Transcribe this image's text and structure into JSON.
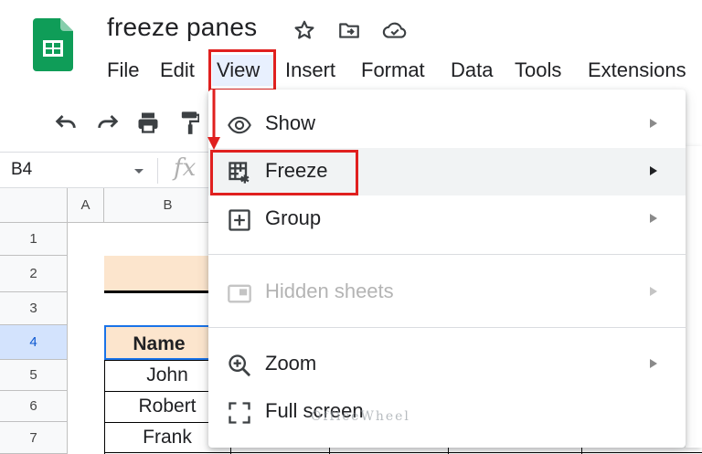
{
  "app": {
    "doc_title": "freeze panes",
    "brand_color": "#0f9d58",
    "highlight_color": "#e0201f"
  },
  "header": {
    "icons": [
      "star-icon",
      "move-to-folder-icon",
      "cloud-status-icon"
    ]
  },
  "menubar": {
    "items": [
      {
        "label": "File"
      },
      {
        "label": "Edit"
      },
      {
        "label": "View"
      },
      {
        "label": "Insert"
      },
      {
        "label": "Format"
      },
      {
        "label": "Data"
      },
      {
        "label": "Tools"
      },
      {
        "label": "Extensions"
      }
    ],
    "active": "View"
  },
  "toolbar": {
    "icons": [
      "undo-icon",
      "redo-icon",
      "print-icon",
      "paint-format-icon"
    ]
  },
  "formula_bar": {
    "name_box": "B4",
    "fx_label": "fx"
  },
  "grid": {
    "columns": [
      "A",
      "B"
    ],
    "rows": [
      "1",
      "2",
      "3",
      "4",
      "5",
      "6",
      "7"
    ],
    "selected_row": "4",
    "cells": {
      "b4": "Name",
      "b5": "John",
      "b6": "Robert",
      "b7": "Frank"
    }
  },
  "view_menu": {
    "items": [
      {
        "label": "Show",
        "icon": "eye-icon",
        "has_submenu": true
      },
      {
        "label": "Freeze",
        "icon": "freeze-grid-icon",
        "has_submenu": true,
        "highlighted": true
      },
      {
        "label": "Group",
        "icon": "plus-box-icon",
        "has_submenu": true
      },
      {
        "label": "Hidden sheets",
        "icon": "hidden-sheet-icon",
        "has_submenu": true,
        "disabled": true
      },
      {
        "label": "Zoom",
        "icon": "zoom-in-icon",
        "has_submenu": true
      },
      {
        "label": "Full screen",
        "icon": "fullscreen-icon",
        "has_submenu": false
      }
    ]
  },
  "watermark": "OfficeWheel"
}
